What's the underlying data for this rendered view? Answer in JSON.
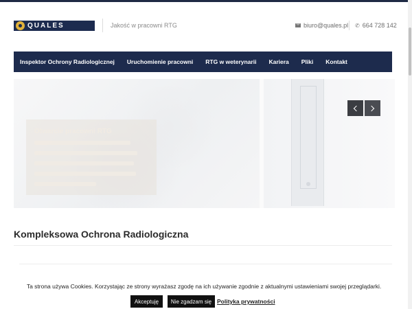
{
  "header": {
    "logo_text": "QUALES",
    "tagline": "Jakość w pracowni RTG",
    "email": "biuro@quales.pl",
    "phone": "664 728 142"
  },
  "nav": {
    "items": [
      {
        "label": "Inspektor Ochrony Radiologicznej"
      },
      {
        "label": "Uruchomienie pracowni"
      },
      {
        "label": "RTG w weterynarii"
      },
      {
        "label": "Kariera"
      },
      {
        "label": "Pliki"
      },
      {
        "label": "Kontakt"
      }
    ]
  },
  "slider": {
    "caption_title": "Otwarcie pracowni RTG",
    "prev_icon": "chevron-left-icon",
    "next_icon": "chevron-right-icon"
  },
  "main": {
    "section_title": "Kompleksowa Ochrona Radiologiczna"
  },
  "cookie": {
    "text": "Ta strona używa Cookies. Korzystając ze strony wyrażasz zgodę na ich używanie zgodnie z aktualnymi ustawieniami swojej przeglądarki.",
    "accept_label": "Akceptuję",
    "reject_label": "Nie zgadzam się",
    "policy_label": "Polityka prywatności"
  },
  "colors": {
    "nav_bg": "#1d2b4d",
    "logo_accent": "#e0b13a"
  }
}
